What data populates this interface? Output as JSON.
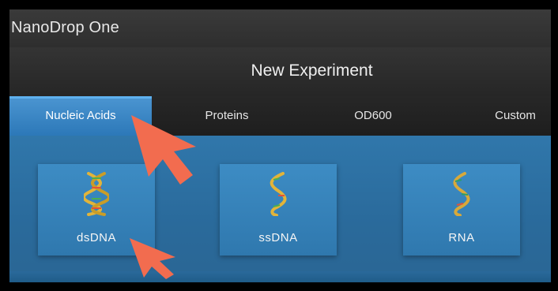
{
  "app": {
    "title": "NanoDrop One"
  },
  "header": {
    "title": "New Experiment"
  },
  "tabs": [
    {
      "label": "Nucleic Acids",
      "active": true
    },
    {
      "label": "Proteins",
      "active": false
    },
    {
      "label": "OD600",
      "active": false
    },
    {
      "label": "Custom",
      "active": false
    }
  ],
  "tiles": [
    {
      "label": "dsDNA",
      "icon": "double-helix-icon"
    },
    {
      "label": "ssDNA",
      "icon": "single-strand-helix-icon"
    },
    {
      "label": "RNA",
      "icon": "rna-helix-icon"
    }
  ],
  "colors": {
    "accent": "#2c78b8",
    "background": "#2b6e9c",
    "header": "#2e2e2e",
    "annotation_arrow": "#f26c4f"
  }
}
